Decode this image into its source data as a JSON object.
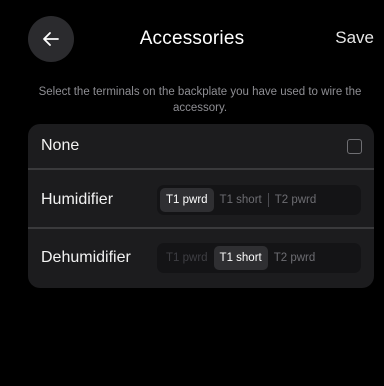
{
  "header": {
    "title": "Accessories",
    "save_label": "Save",
    "back_icon": "arrow-left-icon"
  },
  "instructions": "Select the terminals on the backplate you have used to wire the accessory.",
  "rows": {
    "none": {
      "label": "None",
      "checked": false
    },
    "humidifier": {
      "label": "Humidifier",
      "options": [
        "T1 pwrd",
        "T1 short",
        "T2 pwrd"
      ],
      "selected": "T1 pwrd"
    },
    "dehumidifier": {
      "label": "Dehumidifier",
      "options": [
        "T1 pwrd",
        "T1 short",
        "T2 pwrd"
      ],
      "selected": "T1 short"
    }
  },
  "colors": {
    "background": "#000000",
    "card": "#1c1c1e",
    "segment_selected": "#2f2f32",
    "muted_text": "#8e8e93"
  }
}
